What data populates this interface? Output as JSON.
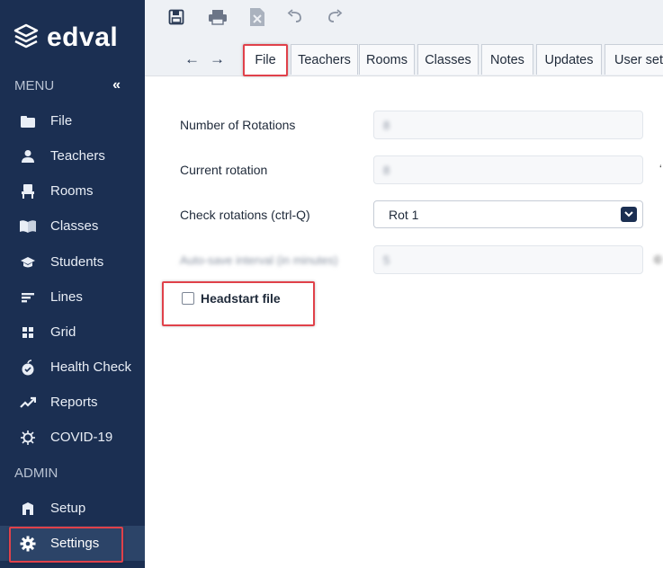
{
  "app": {
    "brand": "edval"
  },
  "sidebar": {
    "menu_label": "MENU",
    "collapse_glyph": "«",
    "admin_label": "ADMIN",
    "items": [
      {
        "label": "File",
        "icon": "folder-icon"
      },
      {
        "label": "Teachers",
        "icon": "person-icon"
      },
      {
        "label": "Rooms",
        "icon": "chair-icon"
      },
      {
        "label": "Classes",
        "icon": "book-icon"
      },
      {
        "label": "Students",
        "icon": "graduation-cap-icon"
      },
      {
        "label": "Lines",
        "icon": "lines-icon"
      },
      {
        "label": "Grid",
        "icon": "grid-icon"
      },
      {
        "label": "Health Check",
        "icon": "apple-icon"
      },
      {
        "label": "Reports",
        "icon": "trend-icon"
      },
      {
        "label": "COVID-19",
        "icon": "virus-icon"
      }
    ],
    "admin_items": [
      {
        "label": "Setup",
        "icon": "building-icon"
      },
      {
        "label": "Settings",
        "icon": "gear-icon",
        "active": true
      }
    ]
  },
  "toolbar": {
    "icons": [
      "save-icon",
      "print-icon",
      "export-icon",
      "undo-icon",
      "redo-icon"
    ],
    "back_glyph": "←",
    "forward_glyph": "→"
  },
  "tabs": [
    {
      "label": "File",
      "active": true
    },
    {
      "label": "Teachers"
    },
    {
      "label": "Rooms"
    },
    {
      "label": "Classes"
    },
    {
      "label": "Notes"
    },
    {
      "label": "Updates"
    },
    {
      "label": "User sett"
    }
  ],
  "form": {
    "rotations_label": "Number of Rotations",
    "rotations_value": "8",
    "current_rotation_label": "Current rotation",
    "current_rotation_value": "8",
    "check_rotations_label": "Check rotations (ctrl-Q)",
    "check_rotations_value": "Rot 1",
    "blurred_label": "Auto-save interval (in minutes)",
    "blurred_value": "5",
    "headstart_label": "Headstart file",
    "headstart_checked": false
  },
  "colors": {
    "sidebar_bg": "#1b2f52",
    "highlight": "#e0414a",
    "accent": "#1b2f52"
  }
}
